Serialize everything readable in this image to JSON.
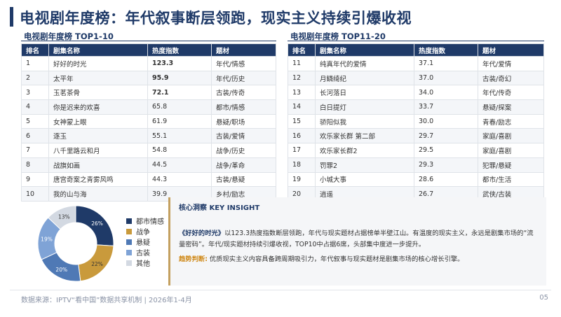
{
  "title": "电视剧年度榜：年代叙事断层领跑，现实主义持续引爆收视",
  "left_table": {
    "label": "电视剧年度榜 TOP1-10",
    "headers": [
      "排名",
      "剧集名称",
      "热度指数",
      "题材"
    ],
    "rows": [
      [
        "1",
        "好好的时光",
        "123.3",
        "年代/情感"
      ],
      [
        "2",
        "太平年",
        "95.9",
        "年代/历史"
      ],
      [
        "3",
        "玉茗茶骨",
        "72.1",
        "古装/传奇"
      ],
      [
        "4",
        "你是迟来的欢喜",
        "65.8",
        "都市/情感"
      ],
      [
        "5",
        "女神蒙上眼",
        "61.9",
        "悬疑/职场"
      ],
      [
        "6",
        "逐玉",
        "55.1",
        "古装/爱情"
      ],
      [
        "7",
        "八千里路云和月",
        "54.8",
        "战争/历史"
      ],
      [
        "8",
        "战旗如画",
        "44.5",
        "战争/革命"
      ],
      [
        "9",
        "唐宫奇案之青雾风鸣",
        "44.3",
        "古装/悬疑"
      ],
      [
        "10",
        "我的山与海",
        "39.9",
        "乡村/励志"
      ]
    ]
  },
  "right_table": {
    "label": "电视剧年度榜 TOP11-20",
    "headers": [
      "排名",
      "剧集名称",
      "热度指数",
      "题材"
    ],
    "rows": [
      [
        "11",
        "纯真年代的爱情",
        "37.1",
        "年代/爱情"
      ],
      [
        "12",
        "月鳞绮纪",
        "37.0",
        "古装/奇幻"
      ],
      [
        "13",
        "长河落日",
        "34.0",
        "年代/传奇"
      ],
      [
        "14",
        "白日提灯",
        "33.7",
        "悬疑/探案"
      ],
      [
        "15",
        "骄阳似我",
        "30.0",
        "青春/励志"
      ],
      [
        "16",
        "欢乐家长群 第二部",
        "29.7",
        "家庭/喜剧"
      ],
      [
        "17",
        "欢乐家长群2",
        "29.5",
        "家庭/喜剧"
      ],
      [
        "18",
        "罚罪2",
        "29.3",
        "犯罪/悬疑"
      ],
      [
        "19",
        "小城大事",
        "28.6",
        "都市/生活"
      ],
      [
        "20",
        "逍遥",
        "26.7",
        "武侠/古装"
      ]
    ]
  },
  "chart_data": {
    "type": "pie",
    "donut": true,
    "categories": [
      "都市情感",
      "战争",
      "悬疑",
      "古装",
      "其他"
    ],
    "values": [
      26,
      22,
      20,
      19,
      13
    ],
    "data_labels": [
      "26%",
      "22%",
      "20%",
      "19%",
      "13%"
    ],
    "colors": [
      "#1f3a68",
      "#c99a3c",
      "#4f79b5",
      "#7fa3d6",
      "#d3d9e2"
    ],
    "legend_placement": "right"
  },
  "insight": {
    "title": "核心洞察 KEY INSIGHT",
    "lead_title": "《好好的时光》",
    "text": "以123.3热度指数断层领跑，年代与现实题材占据榜单半壁江山。有温度的现实主义，永远是剧集市场的“流量密码”。年代/现实题材持续引爆收视，TOP10中占据6席，头部集中度进一步提升。",
    "judge_label": "趋势判断:",
    "judge_text": "优质现实主义内容具备跨周期吸引力，年代叙事与现实题材是剧集市场的核心增长引擎。"
  },
  "footer": {
    "source": "数据来源：IPTV“看中国”数据共享机制 | 2026年1-4月",
    "page": "05"
  }
}
